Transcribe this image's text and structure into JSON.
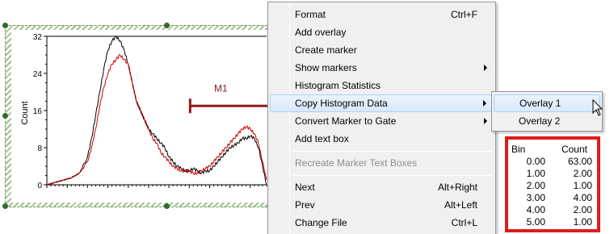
{
  "chart_data": {
    "type": "line",
    "ylabel": "Count",
    "xlabel": "",
    "ylim": [
      0,
      32
    ],
    "yticks": [
      "0",
      "8",
      "16",
      "24",
      "32"
    ],
    "xlim": [
      0,
      270
    ],
    "grid": false,
    "series": [
      {
        "color": "#000000",
        "x": [
          0,
          10,
          20,
          30,
          40,
          50,
          55,
          60,
          65,
          70,
          75,
          80,
          85,
          90,
          95,
          100,
          105,
          110,
          115,
          120,
          125,
          130,
          135,
          140,
          145,
          150,
          155,
          160,
          165,
          170,
          175,
          180,
          185,
          190,
          195,
          200,
          205,
          210,
          215,
          220,
          225,
          230,
          235,
          240,
          245,
          250,
          255,
          260,
          265,
          270
        ],
        "y": [
          0,
          0.5,
          1,
          1.5,
          2.5,
          6,
          10,
          15,
          20,
          25,
          29,
          31,
          32,
          31,
          29,
          26,
          22,
          18,
          16,
          14,
          12,
          11,
          10,
          9,
          8,
          6,
          5,
          4,
          3.5,
          3,
          3,
          3.5,
          3,
          2.5,
          3,
          3,
          4,
          5,
          6,
          7,
          8,
          8.5,
          9,
          10,
          10,
          10.5,
          10,
          8,
          4,
          0
        ]
      },
      {
        "color": "#cc0000",
        "x": [
          0,
          10,
          20,
          30,
          40,
          50,
          55,
          60,
          65,
          70,
          75,
          80,
          85,
          90,
          95,
          100,
          105,
          110,
          115,
          120,
          125,
          130,
          135,
          140,
          145,
          150,
          155,
          160,
          165,
          170,
          175,
          180,
          185,
          190,
          195,
          200,
          205,
          210,
          215,
          220,
          225,
          230,
          235,
          240,
          245,
          250,
          255,
          260,
          265,
          270
        ],
        "y": [
          0,
          0.5,
          1,
          1.5,
          2.5,
          5,
          8,
          12,
          17,
          21,
          24,
          26,
          27,
          28,
          27,
          26,
          22,
          18,
          16,
          14,
          12,
          10,
          9,
          7,
          6,
          5,
          4,
          3.5,
          3,
          3,
          3,
          2.5,
          2.5,
          3,
          3.5,
          4,
          5,
          6,
          7,
          8,
          9,
          10,
          11,
          12,
          12.5,
          12,
          11,
          9,
          5,
          1
        ]
      }
    ],
    "marker": {
      "label": "M1",
      "color": "#8b1a1a",
      "x_start": 176,
      "y_level": 17
    }
  },
  "context_menu": {
    "items": [
      {
        "label": "Format",
        "shortcut": "Ctrl+F"
      },
      {
        "label": "Add overlay",
        "shortcut": ""
      },
      {
        "label": "Create marker",
        "shortcut": ""
      },
      {
        "label": "Show markers",
        "shortcut": ""
      },
      {
        "label": "Histogram Statistics",
        "shortcut": ""
      },
      {
        "label": "Copy Histogram Data",
        "shortcut": ""
      },
      {
        "label": "Convert Marker to Gate",
        "shortcut": ""
      },
      {
        "label": "Add text box",
        "shortcut": ""
      },
      {
        "label": "Recreate Marker Text Boxes",
        "shortcut": ""
      },
      {
        "label": "Next",
        "shortcut": "Alt+Right"
      },
      {
        "label": "Prev",
        "shortcut": "Alt+Left"
      },
      {
        "label": "Change File",
        "shortcut": "Ctrl+L"
      }
    ]
  },
  "submenu": {
    "items": [
      "Overlay 1",
      "Overlay 2"
    ]
  },
  "data_panel": {
    "headers": [
      "Bin",
      "Count"
    ],
    "rows": [
      [
        "0.00",
        "63.00"
      ],
      [
        "1.00",
        "2.00"
      ],
      [
        "2.00",
        "1.00"
      ],
      [
        "3.00",
        "4.00"
      ],
      [
        "4.00",
        "2.00"
      ],
      [
        "5.00",
        "1.00"
      ]
    ],
    "border_color": "#e01b1b"
  }
}
